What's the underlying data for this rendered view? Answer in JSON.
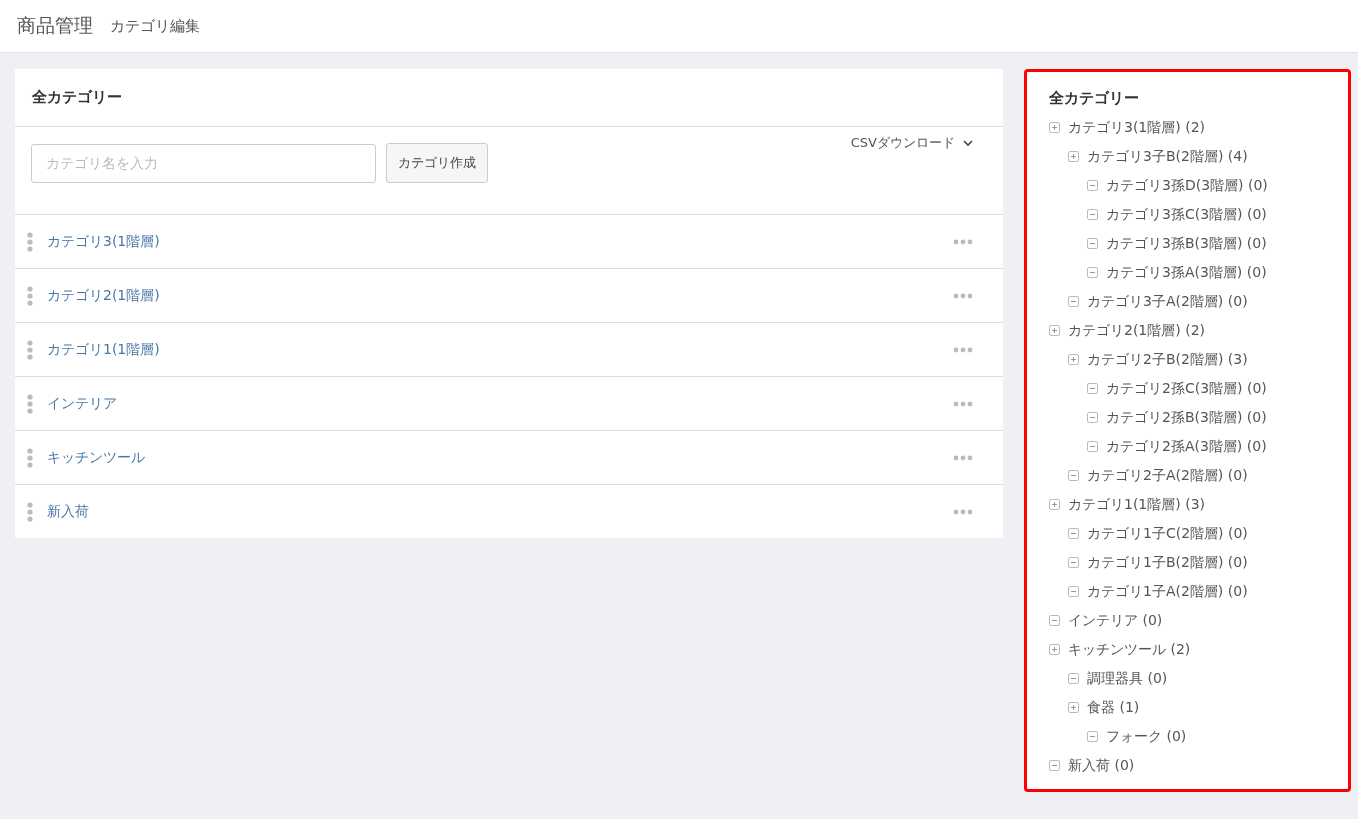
{
  "header": {
    "title": "商品管理",
    "subtitle": "カテゴリ編集"
  },
  "category_list": {
    "title": "全カテゴリー",
    "input": {
      "placeholder": "カテゴリ名を入力"
    },
    "create_button": "カテゴリ作成",
    "csv_download": "CSVダウンロード",
    "rows": [
      {
        "label": "カテゴリ3(1階層)"
      },
      {
        "label": "カテゴリ2(1階層)"
      },
      {
        "label": "カテゴリ1(1階層)"
      },
      {
        "label": "インテリア"
      },
      {
        "label": "キッチンツール"
      },
      {
        "label": "新入荷"
      }
    ]
  },
  "tree_panel": {
    "title": "全カテゴリー",
    "items": [
      {
        "label": "カテゴリ3(1階層) (2)",
        "children": [
          {
            "label": "カテゴリ3子B(2階層) (4)",
            "children": [
              {
                "label": "カテゴリ3孫D(3階層) (0)"
              },
              {
                "label": "カテゴリ3孫C(3階層) (0)"
              },
              {
                "label": "カテゴリ3孫B(3階層) (0)"
              },
              {
                "label": "カテゴリ3孫A(3階層) (0)"
              }
            ]
          },
          {
            "label": "カテゴリ3子A(2階層) (0)"
          }
        ]
      },
      {
        "label": "カテゴリ2(1階層) (2)",
        "children": [
          {
            "label": "カテゴリ2子B(2階層) (3)",
            "children": [
              {
                "label": "カテゴリ2孫C(3階層) (0)"
              },
              {
                "label": "カテゴリ2孫B(3階層) (0)"
              },
              {
                "label": "カテゴリ2孫A(3階層) (0)"
              }
            ]
          },
          {
            "label": "カテゴリ2子A(2階層) (0)"
          }
        ]
      },
      {
        "label": "カテゴリ1(1階層) (3)",
        "children": [
          {
            "label": "カテゴリ1子C(2階層) (0)"
          },
          {
            "label": "カテゴリ1子B(2階層) (0)"
          },
          {
            "label": "カテゴリ1子A(2階層) (0)"
          }
        ]
      },
      {
        "label": "インテリア (0)"
      },
      {
        "label": "キッチンツール (2)",
        "children": [
          {
            "label": "調理器具 (0)"
          },
          {
            "label": "食器 (1)",
            "children": [
              {
                "label": "フォーク (0)"
              }
            ]
          }
        ]
      },
      {
        "label": "新入荷 (0)"
      }
    ]
  }
}
